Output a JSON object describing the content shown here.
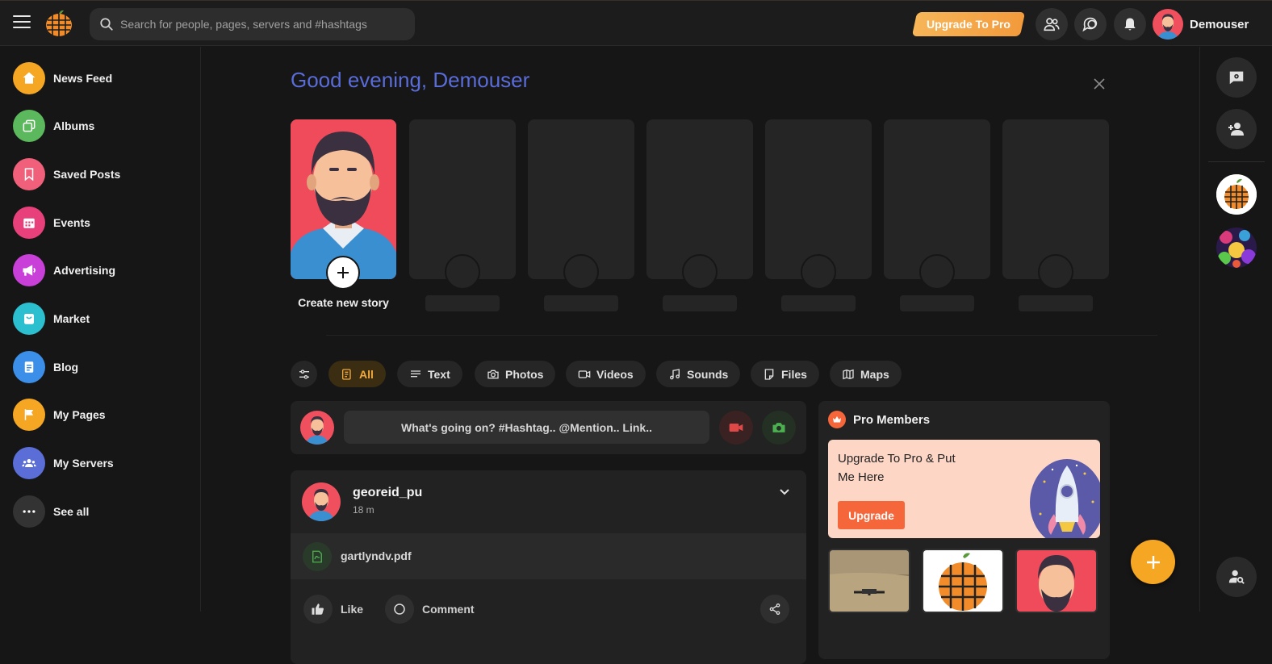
{
  "topbar": {
    "search_placeholder": "Search for people, pages, servers and #hashtags",
    "upgrade_label": "Upgrade To Pro",
    "username": "Demouser"
  },
  "sidebar": {
    "items": [
      {
        "label": "News Feed",
        "icon": "home-icon",
        "color": "#f5a623"
      },
      {
        "label": "Albums",
        "icon": "albums-icon",
        "color": "#5cb85c"
      },
      {
        "label": "Saved Posts",
        "icon": "bookmark-icon",
        "color": "#f0607a"
      },
      {
        "label": "Events",
        "icon": "calendar-icon",
        "color": "#e8407a"
      },
      {
        "label": "Advertising",
        "icon": "megaphone-icon",
        "color": "#c940d8"
      },
      {
        "label": "Market",
        "icon": "shopping-bag-icon",
        "color": "#2bbfd0"
      },
      {
        "label": "Blog",
        "icon": "document-icon",
        "color": "#3b8fe8"
      },
      {
        "label": "My Pages",
        "icon": "flag-icon",
        "color": "#f5a623"
      },
      {
        "label": "My Servers",
        "icon": "group-icon",
        "color": "#5b6ed8"
      },
      {
        "label": "See all",
        "icon": "more-icon",
        "color": "#333333"
      }
    ]
  },
  "main": {
    "greeting": "Good evening, Demouser",
    "create_story_label": "Create new story",
    "filters": [
      "All",
      "Text",
      "Photos",
      "Videos",
      "Sounds",
      "Files",
      "Maps"
    ],
    "active_filter": "All",
    "composer_placeholder": "What's going on? #Hashtag.. @Mention.. Link..",
    "post": {
      "author": "georeid_pu",
      "time": "18 m",
      "file_name": "gartlyndv.pdf",
      "like_label": "Like",
      "comment_label": "Comment"
    },
    "pro_members": {
      "title": "Pro Members",
      "promo_text": "Upgrade To Pro & Put Me Here",
      "promo_button": "Upgrade"
    }
  },
  "colors": {
    "accent": "#f5a623",
    "greeting": "#5a6cd8",
    "promo_button": "#f5663a"
  }
}
